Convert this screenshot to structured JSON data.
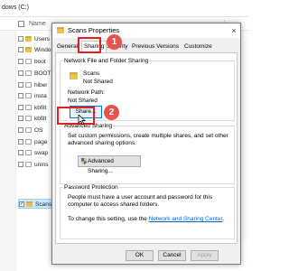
{
  "explorer": {
    "address": "dows (C:)",
    "column_header": "Name",
    "items": [
      {
        "name": "Users",
        "type": "folder"
      },
      {
        "name": "Windo",
        "type": "folder"
      },
      {
        "name": "boot",
        "type": "doc"
      },
      {
        "name": "BOOT",
        "type": "doc"
      },
      {
        "name": "hiber",
        "type": "doc"
      },
      {
        "name": "insta",
        "type": "doc"
      },
      {
        "name": "kbfilt",
        "type": "doc"
      },
      {
        "name": "kbfilt",
        "type": "doc"
      },
      {
        "name": "OS",
        "type": "doc"
      },
      {
        "name": "page",
        "type": "doc"
      },
      {
        "name": "swap",
        "type": "doc"
      },
      {
        "name": "unins",
        "type": "doc"
      },
      {
        "name": "Scans",
        "type": "folder"
      }
    ]
  },
  "dialog": {
    "title": "Scans Properties",
    "close_label": "×",
    "tabs": [
      "General",
      "Sharing",
      "Security",
      "Previous Versions",
      "Customize"
    ],
    "network_sharing": {
      "title": "Network File and Folder Sharing",
      "folder_name": "Scans",
      "share_status": "Not Shared",
      "network_path_label": "Network Path:",
      "network_path_value": "Not Shared",
      "share_button": "Share..."
    },
    "advanced_sharing": {
      "title": "Advanced Sharing",
      "description": "Set custom permissions, create multiple shares, and set other advanced sharing options.",
      "button": "Advanced Sharing..."
    },
    "password_protection": {
      "title": "Password Protection",
      "description": "People must have a user account and password for this computer to access shared folders.",
      "change_text": "To change this setting, use the",
      "link_text": "Network and Sharing Center",
      "period": "."
    },
    "footer": {
      "ok": "OK",
      "cancel": "Cancel",
      "apply": "Apply"
    }
  },
  "callouts": [
    "1",
    "2"
  ],
  "colors": {
    "highlight_red": "#e02020",
    "callout_red": "#e8534f",
    "link_blue": "#0066cc"
  }
}
